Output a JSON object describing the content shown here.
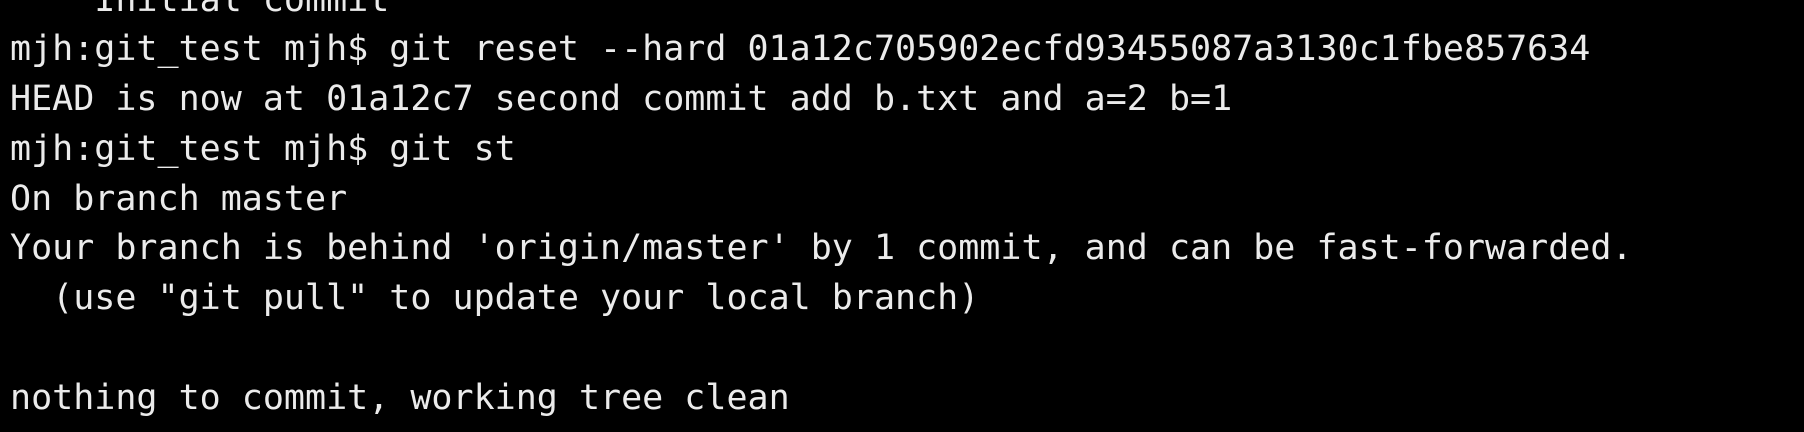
{
  "terminal": {
    "lines": [
      "    Initial commit",
      "mjh:git_test mjh$ git reset --hard 01a12c705902ecfd93455087a3130c1fbe857634",
      "HEAD is now at 01a12c7 second commit add b.txt and a=2 b=1",
      "mjh:git_test mjh$ git st",
      "On branch master",
      "Your branch is behind 'origin/master' by 1 commit, and can be fast-forwarded.",
      "  (use \"git pull\" to update your local branch)",
      "",
      "nothing to commit, working tree clean"
    ]
  },
  "colors": {
    "background": "#000000",
    "text": "#ebebeb"
  }
}
